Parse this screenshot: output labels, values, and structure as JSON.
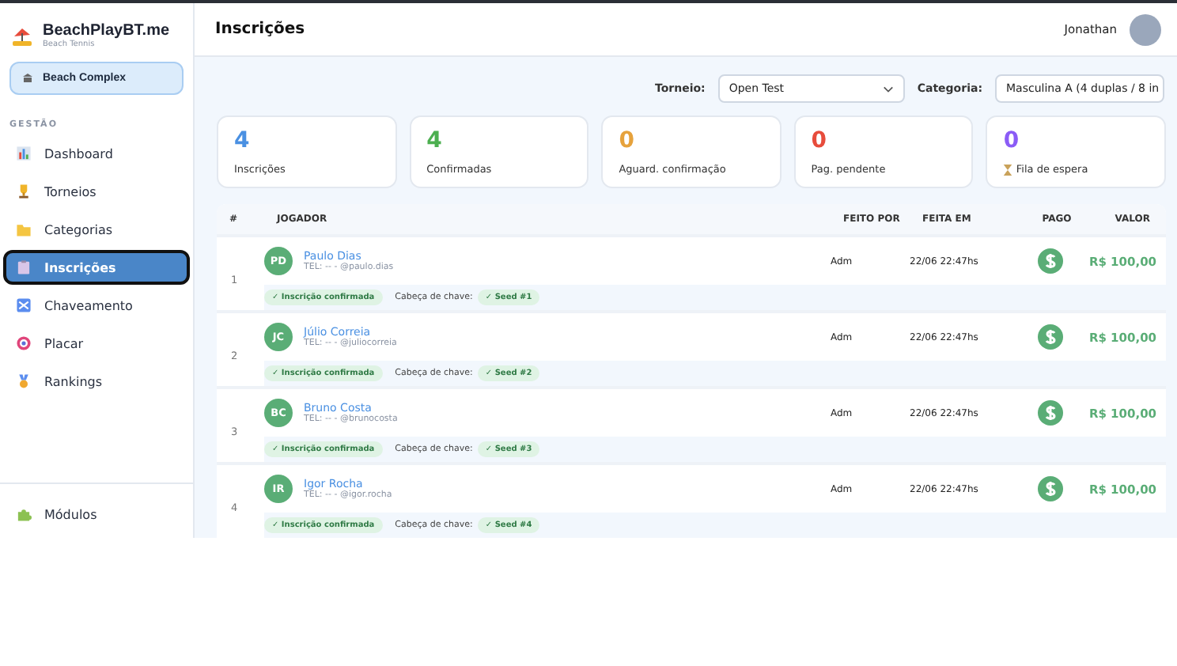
{
  "brand": {
    "name": "BeachPlayBT.me",
    "tagline": "Beach Tennis"
  },
  "venue": "Beach Complex",
  "sidebar": {
    "section": "GESTÃO",
    "items": [
      {
        "label": "Dashboard",
        "kind": "chart",
        "selected": false
      },
      {
        "label": "Torneios",
        "kind": "trophy",
        "selected": false
      },
      {
        "label": "Categorias",
        "kind": "folder",
        "selected": false
      },
      {
        "label": "Inscrições",
        "kind": "clipboard",
        "selected": true
      },
      {
        "label": "Chaveamento",
        "kind": "shuffle",
        "selected": false
      },
      {
        "label": "Placar",
        "kind": "target",
        "selected": false
      },
      {
        "label": "Rankings",
        "kind": "medal",
        "selected": false
      }
    ],
    "footer": {
      "label": "Módulos",
      "kind": "puzzle",
      "selected": false
    }
  },
  "header": {
    "title": "Inscrições",
    "user": "Jonathan"
  },
  "filters": [
    {
      "label": "Torneio:",
      "value": "Open Test"
    },
    {
      "label": "Categoria:",
      "value": "Masculina A (4 duplas / 8 in"
    }
  ],
  "stats": [
    {
      "value": "4",
      "label": "Inscrições",
      "color": "#4a90e2",
      "icon": false
    },
    {
      "value": "4",
      "label": "Confirmadas",
      "color": "#4caf50",
      "icon": false
    },
    {
      "value": "0",
      "label": "Aguard. confirmação",
      "color": "#e6a23c",
      "icon": false
    },
    {
      "value": "0",
      "label": "Pag. pendente",
      "color": "#e74c3c",
      "icon": false
    },
    {
      "value": "0",
      "label": "Fila de espera",
      "color": "#8b5cf6",
      "icon": true
    }
  ],
  "table": {
    "columns": [
      "#",
      "JOGADOR",
      "FEITO POR",
      "FEITA EM",
      "PAGO",
      "VALOR"
    ],
    "rows": [
      {
        "index": "1",
        "initials": "PD",
        "name": "Paulo Dias",
        "contact": "TEL: -- - @paulo.dias",
        "by": "Adm",
        "date": "22/06 22:47hs",
        "paid": true,
        "value": "R$ 100,00",
        "status": "✓ Inscrição confirmada",
        "seed_label": "Cabeça de chave:",
        "seed": "✓ Seed #1"
      },
      {
        "index": "2",
        "initials": "JC",
        "name": "Júlio Correia",
        "contact": "TEL: -- - @juliocorreia",
        "by": "Adm",
        "date": "22/06 22:47hs",
        "paid": true,
        "value": "R$ 100,00",
        "status": "✓ Inscrição confirmada",
        "seed_label": "Cabeça de chave:",
        "seed": "✓ Seed #2"
      },
      {
        "index": "3",
        "initials": "BC",
        "name": "Bruno Costa",
        "contact": "TEL: -- - @brunocosta",
        "by": "Adm",
        "date": "22/06 22:47hs",
        "paid": true,
        "value": "R$ 100,00",
        "status": "✓ Inscrição confirmada",
        "seed_label": "Cabeça de chave:",
        "seed": "✓ Seed #3"
      },
      {
        "index": "4",
        "initials": "IR",
        "name": "Igor Rocha",
        "contact": "TEL: -- - @igor.rocha",
        "by": "Adm",
        "date": "22/06 22:47hs",
        "paid": true,
        "value": "R$ 100,00",
        "status": "✓ Inscrição confirmada",
        "seed_label": "Cabeça de chave:",
        "seed": "✓ Seed #4"
      }
    ]
  }
}
